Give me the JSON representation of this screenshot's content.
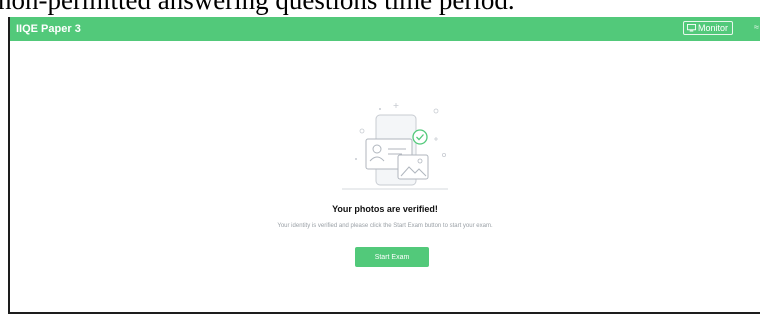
{
  "doc": {
    "overlay_text": "non-permitted answering questions time period."
  },
  "app": {
    "title": "IIQE Paper 3",
    "monitor_label": "Monitor",
    "accent": "#52c97a"
  },
  "main": {
    "heading": "Your photos are verified!",
    "subtext": "Your identity is verified and please click the Start Exam button to start your exam.",
    "start_button": "Start Exam"
  },
  "icons": {
    "monitor": "monitor-icon",
    "corner": "wifi-icon",
    "illustration": "id-photo-verified-illustration"
  }
}
